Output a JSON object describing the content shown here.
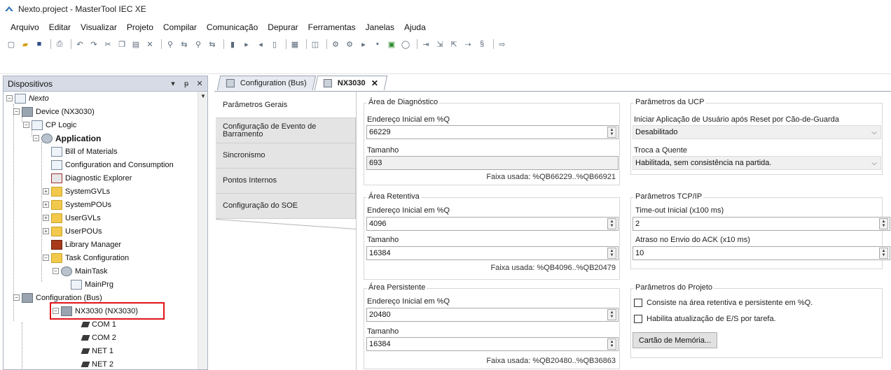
{
  "window": {
    "title": "Nexto.project - MasterTool IEC XE"
  },
  "menu": [
    "Arquivo",
    "Editar",
    "Visualizar",
    "Projeto",
    "Compilar",
    "Comunicação",
    "Depurar",
    "Ferramentas",
    "Janelas",
    "Ajuda"
  ],
  "toolbar_icons": [
    "new-icon",
    "open-icon",
    "save-icon",
    "print-icon",
    "undo-icon",
    "redo-icon",
    "cut-icon",
    "copy-icon",
    "paste-icon",
    "delete-icon",
    "find-icon",
    "replace-icon",
    "find-next-icon",
    "find-prev-icon",
    "bookmark-icon",
    "bookmark-next-icon",
    "bookmark-prev-icon",
    "bookmark-clear-icon",
    "build-icon",
    "generate-icon",
    "login-icon",
    "logout-icon",
    "run-icon",
    "stop-icon",
    "reset-icon",
    "breakpoint-icon",
    "step-over-icon",
    "step-into-icon",
    "step-out-icon",
    "set-next-icon",
    "show-next-icon",
    "write-icon"
  ],
  "devices_panel": {
    "title": "Dispositivos",
    "pin": "▾ ᵽ",
    "close": "✕",
    "tree": [
      {
        "label": "Nexto",
        "icon": "project-icon",
        "style": "italic"
      },
      {
        "label": "Device (NX3030)",
        "icon": "device-icon"
      },
      {
        "label": "CP Logic",
        "icon": "plc-logic-icon"
      },
      {
        "label": "Application",
        "icon": "application-icon",
        "style": "bold"
      },
      {
        "label": "Bill of Materials",
        "icon": "document-icon"
      },
      {
        "label": "Configuration and Consumption",
        "icon": "document-icon"
      },
      {
        "label": "Diagnostic Explorer",
        "icon": "diagnostic-icon"
      },
      {
        "label": "SystemGVLs",
        "icon": "folder-icon"
      },
      {
        "label": "SystemPOUs",
        "icon": "folder-icon"
      },
      {
        "label": "UserGVLs",
        "icon": "folder-icon"
      },
      {
        "label": "UserPOUs",
        "icon": "folder-icon"
      },
      {
        "label": "Library Manager",
        "icon": "library-icon"
      },
      {
        "label": "Task Configuration",
        "icon": "task-config-icon"
      },
      {
        "label": "MainTask",
        "icon": "task-icon"
      },
      {
        "label": "MainPrg",
        "icon": "program-icon"
      },
      {
        "label": "Configuration (Bus)",
        "icon": "device-icon"
      },
      {
        "label": "NX3030 (NX3030)",
        "icon": "device-icon"
      },
      {
        "label": "COM 1",
        "icon": "port-icon"
      },
      {
        "label": "COM 2",
        "icon": "port-icon"
      },
      {
        "label": "NET 1",
        "icon": "port-icon"
      },
      {
        "label": "NET 2",
        "icon": "port-icon"
      }
    ]
  },
  "tabs": [
    {
      "label": "Configuration (Bus)",
      "active": false
    },
    {
      "label": "NX3030",
      "active": true,
      "close": "✕"
    }
  ],
  "sidenav": [
    "Parâmetros Gerais",
    "Configuração de Evento de Barramento",
    "Sincronismo",
    "Pontos Internos",
    "Configuração do SOE"
  ],
  "diag": {
    "title": "Área de Diagnóstico",
    "addr_label": "Endereço Inicial em %Q",
    "addr_value": "66229",
    "size_label": "Tamanho",
    "size_value": "693",
    "range": "Faixa usada: %QB66229..%QB66921"
  },
  "retentive": {
    "title": "Área Retentiva",
    "addr_label": "Endereço Inicial em %Q",
    "addr_value": "4096",
    "size_label": "Tamanho",
    "size_value": "16384",
    "range": "Faixa usada: %QB4096..%QB20479"
  },
  "persistent": {
    "title": "Área Persistente",
    "addr_label": "Endereço Inicial em %Q",
    "addr_value": "20480",
    "size_label": "Tamanho",
    "size_value": "16384",
    "range": "Faixa usada: %QB20480..%QB36863"
  },
  "ucp": {
    "title": "Parâmetros da UCP",
    "start_label": "Iniciar Aplicação de Usuário após Reset por Cão-de-Guarda",
    "start_value": "Desabilitado",
    "hot_label": "Troca a Quente",
    "hot_value": "Habilitada, sem consistência na partida."
  },
  "tcp": {
    "title": "Parâmetros TCP/IP",
    "timeout_label": "Time-out Inicial (x100 ms)",
    "timeout_value": "2",
    "ack_label": "Atraso no Envio do ACK (x10 ms)",
    "ack_value": "10"
  },
  "project": {
    "title": "Parâmetros do Projeto",
    "check1": "Consiste na área retentiva e persistente em %Q.",
    "check2": "Habilita atualização de E/S por tarefa.",
    "button": "Cartão de Memória..."
  },
  "colors": {
    "highlight": "#e0141a",
    "panel_header": "#d6dbe6"
  }
}
